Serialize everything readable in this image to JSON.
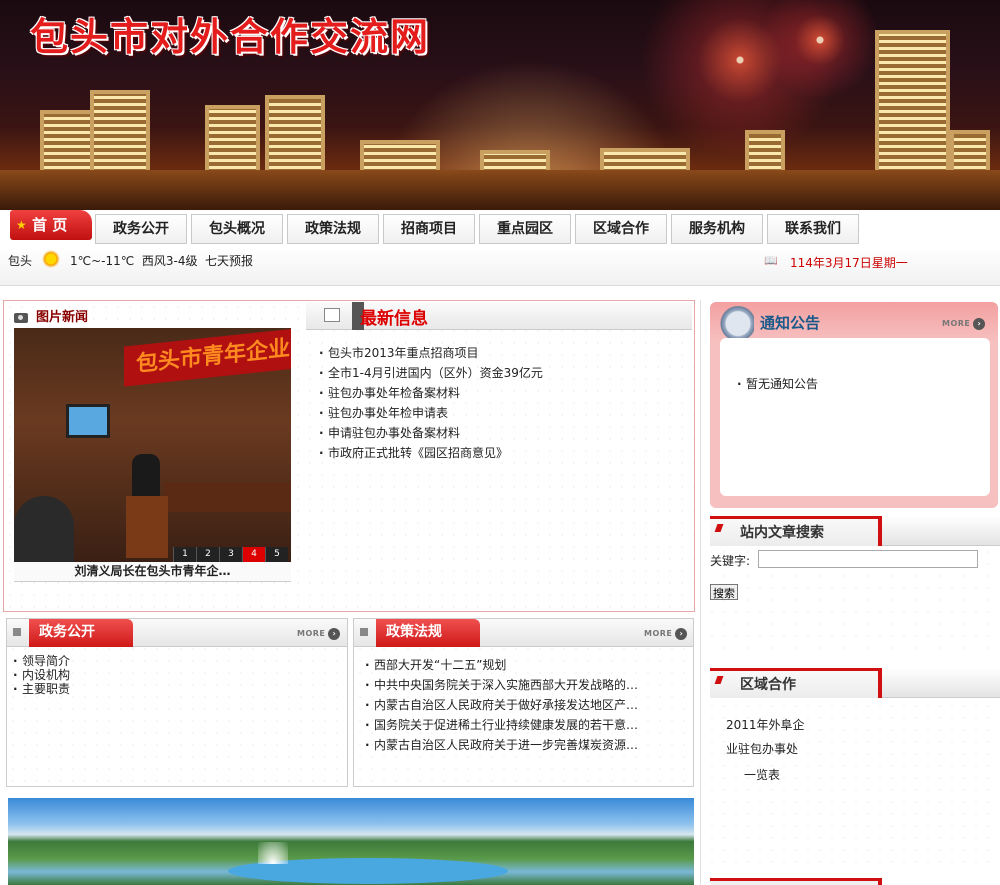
{
  "site": {
    "title": "包头市对外合作交流网"
  },
  "nav": {
    "home": "首 页",
    "items": [
      "政务公开",
      "包头概况",
      "政策法规",
      "招商项目",
      "重点园区",
      "区域合作",
      "服务机构",
      "联系我们"
    ]
  },
  "infobar": {
    "city": "包头",
    "weather": "1℃~-11℃  西风3-4级",
    "forecast": "七天预报",
    "date": "114年3月17日星期一"
  },
  "picture_news": {
    "title": "图片新闻",
    "caption": "刘清义局长在包头市青年企…",
    "banner_text": "包头市青年企业",
    "pages": [
      "1",
      "2",
      "3",
      "4",
      "5"
    ],
    "active_page": "4"
  },
  "latest_info": {
    "title": "最新信息",
    "items": [
      "包头市2013年重点招商项目",
      "全市1-4月引进国内（区外）资金39亿元",
      "驻包办事处年检备案材料",
      "驻包办事处年检申请表",
      "申请驻包办事处备案材料",
      "市政府正式批转《园区招商意见》"
    ]
  },
  "notice": {
    "title": "通知公告",
    "more": "MORE",
    "items": [
      "暂无通知公告"
    ]
  },
  "search": {
    "title": "站内文章搜索",
    "keyword_label": "关键字:",
    "value": "",
    "button": "搜索"
  },
  "regional": {
    "title": "区域合作",
    "lines": [
      "2011年外阜企",
      "业驻包办事处",
      "一览表"
    ]
  },
  "gov_affairs": {
    "title": "政务公开",
    "more": "MORE",
    "items": [
      "领导简介",
      "内设机构",
      "主要职责"
    ]
  },
  "policy": {
    "title": "政策法规",
    "more": "MORE",
    "items": [
      "西部大开发“十二五”规划",
      "中共中央国务院关于深入实施西部大开发战略的…",
      "内蒙古自治区人民政府关于做好承接发达地区产…",
      "国务院关于促进稀土行业持续健康发展的若干意…",
      "内蒙古自治区人民政府关于进一步完善煤炭资源…"
    ]
  },
  "colors": {
    "brand_red": "#d01010",
    "date_red": "#cc0000",
    "notice_pink": "#f7c0c0"
  }
}
